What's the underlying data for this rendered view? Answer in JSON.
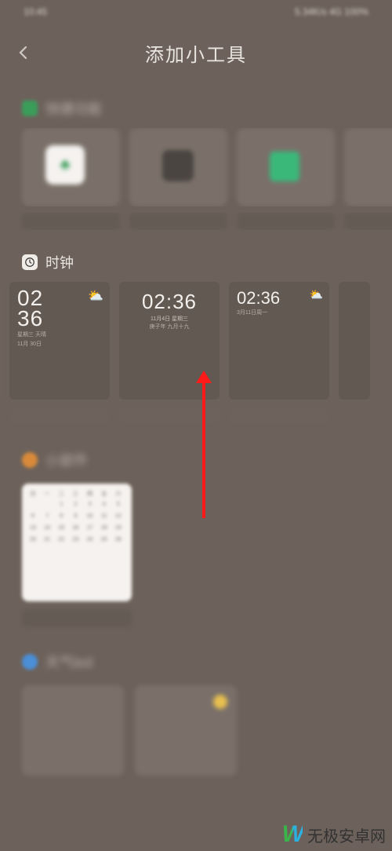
{
  "status": {
    "left": "10:45",
    "right": "5.34K/s 4G 100%"
  },
  "header": {
    "title": "添加小工具"
  },
  "sections": {
    "s1": {
      "title": "快捷功能"
    },
    "clock": {
      "title": "时钟",
      "card1": {
        "hour": "02",
        "min": "36",
        "sub1": "星期三 天晴",
        "sub2": "11月 30日"
      },
      "card2": {
        "time": "02:36",
        "sub1": "11月4日  星期三",
        "sub2": "庚子年 九月十九"
      },
      "card3": {
        "time": "02:36",
        "sub": "3月11日周一"
      }
    },
    "s3": {
      "title": "小部件"
    },
    "s4": {
      "title": "天气led"
    }
  },
  "watermark": {
    "text": "无极安卓网"
  },
  "colors": {
    "arrow": "#ff1a1a"
  }
}
